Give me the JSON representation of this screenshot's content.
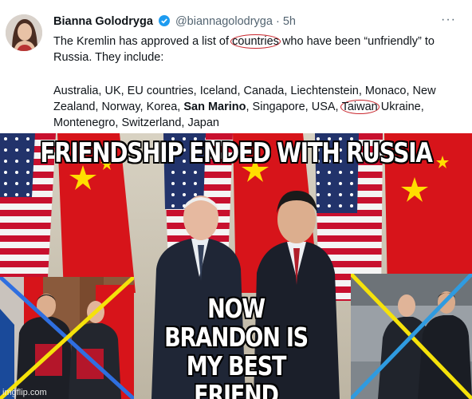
{
  "tweet": {
    "author_name": "Bianna Golodryga",
    "handle": "@biannagolodryga",
    "separator": "·",
    "time": "5h",
    "more_icon": "more-horizontal-icon",
    "verified_icon": "verified-badge-icon",
    "line1_before": "The Kremlin has approved a list of ",
    "line1_circled": "countries",
    "line1_after": " who have been “unfriendly” to Russia. They include:",
    "list_part1": " Australia, UK, EU countries, Iceland, Canada, Liechtenstein, Monaco, New Zealand, Norway, Korea, ",
    "list_bold": "San Marino",
    "list_part2": ", Singapore, USA, ",
    "list_circled": "Taiwan",
    "list_part3": " Ukraine, Montenegro, Switzerland, Japan",
    "annotation_color": "#c9252c"
  },
  "meme": {
    "top_caption": "FRIENDSHIP ENDED WITH RUSSIA",
    "bottom_caption": "NOW BRANDON IS MY BEST FRIEND",
    "watermark": "imgflip.com",
    "cross_colors": [
      "#2f6fe0",
      "#f5e20a"
    ]
  }
}
